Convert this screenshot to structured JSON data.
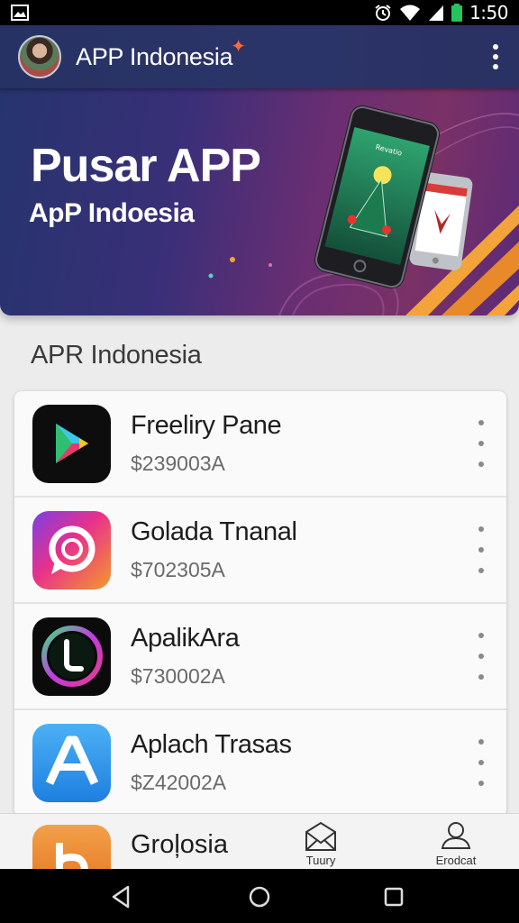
{
  "status_bar": {
    "time": "1:50",
    "icons": [
      "image-icon",
      "alarm-icon",
      "wifi-icon",
      "signal-icon",
      "battery-icon"
    ],
    "battery_color": "#22c55e"
  },
  "app_bar": {
    "title": "APP Indonesia",
    "accent": "#ff6a3d"
  },
  "hero": {
    "title": "Pusar APP",
    "subtitle": "ApP Indoesia",
    "phone_text": "Revatio"
  },
  "section": {
    "title": "APR Indonesia"
  },
  "apps": [
    {
      "name": "Freeliry Pane",
      "price": "$239003A",
      "icon": "play-store-icon"
    },
    {
      "name": "Golada Tnanal",
      "price": "$702305A",
      "icon": "chat-ring-icon"
    },
    {
      "name": "ApalikAra",
      "price": "$730002A",
      "icon": "ring-l-icon"
    },
    {
      "name": "Aplach Trasas",
      "price": "$Z42002A",
      "icon": "letter-a-icon"
    }
  ],
  "peek_app": {
    "name": "Groļosia",
    "icon": "letter-b-icon"
  },
  "tabs": [
    {
      "label": "Tuury",
      "icon": "envelope-icon"
    },
    {
      "label": "Erodcat",
      "icon": "person-icon"
    }
  ],
  "nav": [
    "back-icon",
    "home-icon",
    "recents-icon"
  ]
}
